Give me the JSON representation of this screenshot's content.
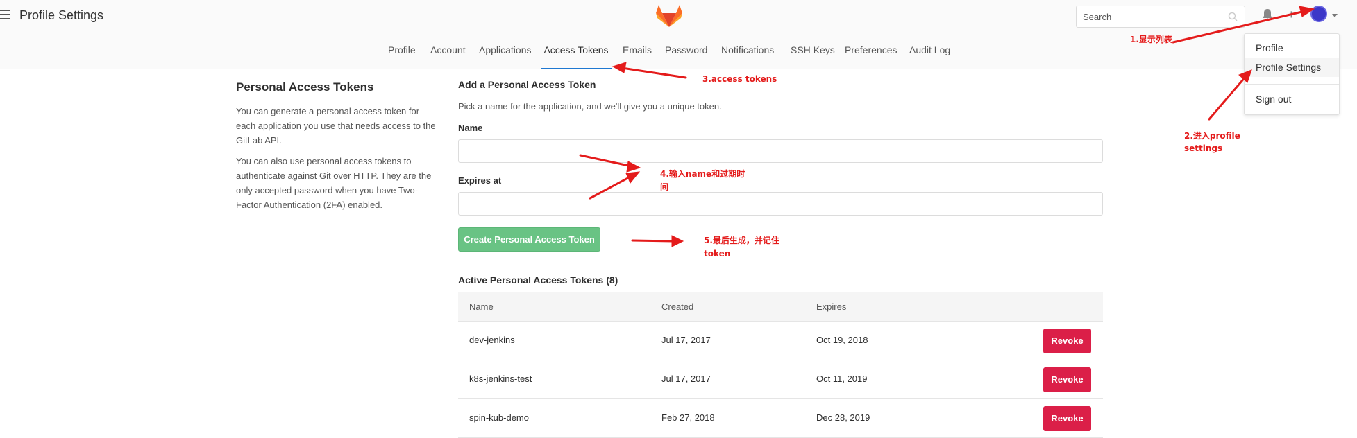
{
  "header": {
    "title": "Profile Settings",
    "search_placeholder": "Search"
  },
  "tabs": [
    "Profile",
    "Account",
    "Applications",
    "Access Tokens",
    "Emails",
    "Password",
    "Notifications",
    "SSH Keys",
    "Preferences",
    "Audit Log"
  ],
  "active_tab": "Access Tokens",
  "dropdown": {
    "items": [
      "Profile",
      "Profile Settings",
      "Sign out"
    ],
    "highlighted": "Profile Settings"
  },
  "sidebar": {
    "title": "Personal Access Tokens",
    "p1": "You can generate a personal access token for each application you use that needs access to the GitLab API.",
    "p2": "You can also use personal access tokens to authenticate against Git over HTTP. They are the only accepted password when you have Two-Factor Authentication (2FA) enabled."
  },
  "form": {
    "title": "Add a Personal Access Token",
    "description": "Pick a name for the application, and we'll give you a unique token.",
    "name_label": "Name",
    "name_value": "",
    "expires_label": "Expires at",
    "expires_value": "",
    "create_button": "Create Personal Access Token"
  },
  "active_tokens": {
    "title": "Active Personal Access Tokens (8)",
    "columns": [
      "Name",
      "Created",
      "Expires"
    ],
    "rows": [
      {
        "name": "dev-jenkins",
        "created": "Jul 17, 2017",
        "expires": "Oct 19, 2018",
        "action": "Revoke"
      },
      {
        "name": "k8s-jenkins-test",
        "created": "Jul 17, 2017",
        "expires": "Oct 11, 2019",
        "action": "Revoke"
      },
      {
        "name": "spin-kub-demo",
        "created": "Feb 27, 2018",
        "expires": "Dec 28, 2019",
        "action": "Revoke"
      }
    ]
  },
  "annotations": {
    "a1": "1.显示列表",
    "a2_line1": "2.进入profile",
    "a2_line2": "settings",
    "a3": "3.access tokens",
    "a4_line1": "4.输入name和过期时",
    "a4_line2": "间",
    "a5_line1": "5.最后生成，并记住",
    "a5_line2": "token"
  },
  "colors": {
    "accent": "#1f78d1",
    "create_button": "#69c384",
    "revoke_button": "#db1f48",
    "annotation": "#e41b1b"
  }
}
